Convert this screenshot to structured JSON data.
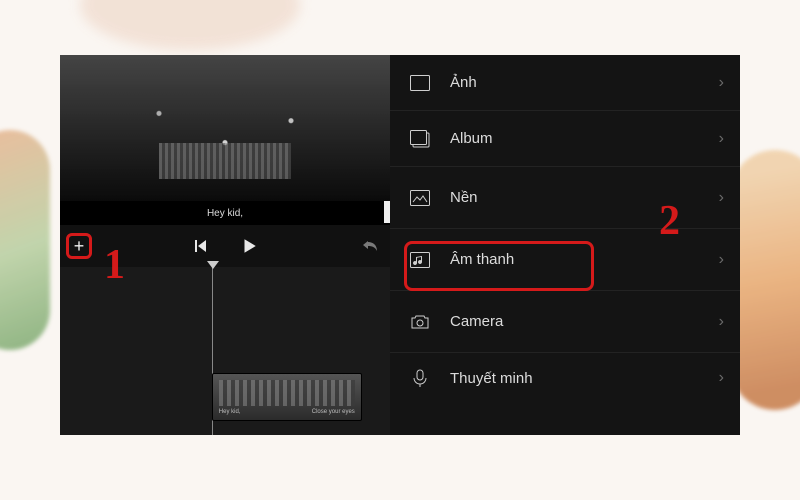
{
  "caption": "Hey kid,",
  "callouts": {
    "one": "1",
    "two": "2"
  },
  "transport": {
    "add": "+"
  },
  "clip": {
    "left_caption": "Hey kid,",
    "right_caption": "Close your eyes"
  },
  "menu": [
    {
      "label": "Ảnh",
      "icon": "photo-icon"
    },
    {
      "label": "Album",
      "icon": "album-icon"
    },
    {
      "label": "Nền",
      "icon": "background-icon"
    },
    {
      "label": "Âm thanh",
      "icon": "audio-icon"
    },
    {
      "label": "Camera",
      "icon": "camera-icon"
    },
    {
      "label": "Thuyết minh",
      "icon": "mic-icon"
    }
  ],
  "colors": {
    "accent_annotation": "#d51a1a",
    "panel_bg": "#141414"
  }
}
